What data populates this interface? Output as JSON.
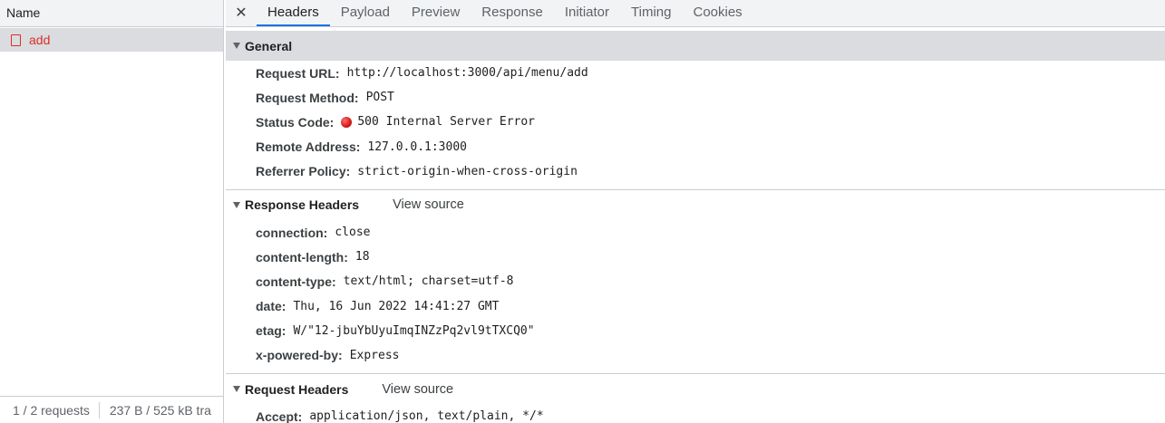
{
  "left": {
    "header": "Name",
    "request_name": "add",
    "footer_count": "1 / 2 requests",
    "footer_size": "237 B / 525 kB tra"
  },
  "tabs": [
    "Headers",
    "Payload",
    "Preview",
    "Response",
    "Initiator",
    "Timing",
    "Cookies"
  ],
  "active_tab": "Headers",
  "close_glyph": "✕",
  "general": {
    "title": "General",
    "rows": [
      {
        "key": "Request URL:",
        "value": "http://localhost:3000/api/menu/add"
      },
      {
        "key": "Request Method:",
        "value": "POST"
      },
      {
        "key": "Status Code:",
        "value": "500 Internal Server Error"
      },
      {
        "key": "Remote Address:",
        "value": "127.0.0.1:3000"
      },
      {
        "key": "Referrer Policy:",
        "value": "strict-origin-when-cross-origin"
      }
    ]
  },
  "response_headers": {
    "title": "Response Headers",
    "view_source": "View source",
    "rows": [
      {
        "key": "connection:",
        "value": "close"
      },
      {
        "key": "content-length:",
        "value": "18"
      },
      {
        "key": "content-type:",
        "value": "text/html; charset=utf-8"
      },
      {
        "key": "date:",
        "value": "Thu, 16 Jun 2022 14:41:27 GMT"
      },
      {
        "key": "etag:",
        "value": "W/\"12-jbuYbUyuImqINZzPq2vl9tTXCQ0\""
      },
      {
        "key": "x-powered-by:",
        "value": "Express"
      }
    ]
  },
  "request_headers": {
    "title": "Request Headers",
    "view_source": "View source",
    "rows": [
      {
        "key": "Accept:",
        "value": "application/json, text/plain, */*"
      }
    ]
  },
  "colors": {
    "error": "#d93025",
    "accent": "#1a73e8",
    "status_dot": "#d21a1a"
  }
}
